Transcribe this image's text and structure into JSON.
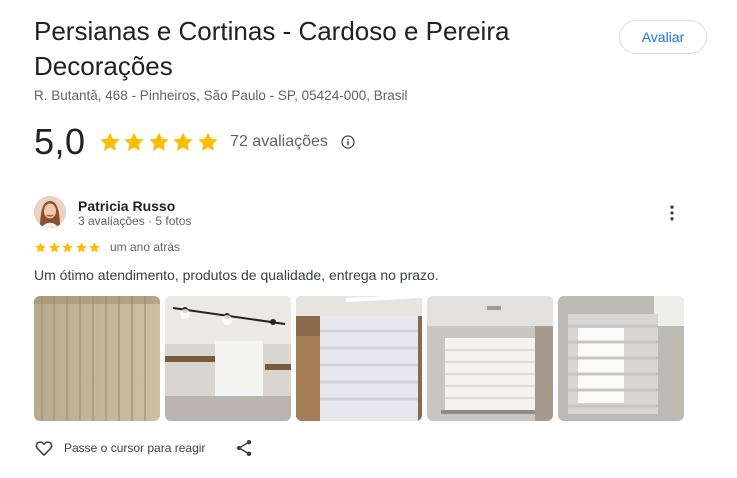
{
  "place": {
    "title": "Persianas e Cortinas - Cardoso e Pereira Decorações",
    "address": "R. Butantã, 468 - Pinheiros, São Paulo - SP, 05424-000, Brasil",
    "rate_button": "Avaliar"
  },
  "summary": {
    "score": "5,0",
    "stars": 5,
    "review_count": "72 avaliações"
  },
  "review": {
    "author": "Patricia Russo",
    "author_meta": "3 avaliações · 5 fotos",
    "stars": 5,
    "time": "um ano atrás",
    "text": "Um ótimo atendimento, produtos de qualidade, entrega no prazo.",
    "photos": [
      "photo-beige-curtain",
      "photo-room-ceiling-lights",
      "photo-sheer-roller-blind",
      "photo-window-blind-room",
      "photo-zebra-blind-window"
    ]
  },
  "actions": {
    "react_label": "Passe o cursor para reagir"
  },
  "icons": {
    "star": "star-icon",
    "info": "info-icon",
    "more": "more-vert-icon",
    "like": "heart-icon",
    "share": "share-icon"
  },
  "colors": {
    "star": "#fbbc04",
    "link": "#1a73e8",
    "secondary_text": "#5f6368"
  }
}
